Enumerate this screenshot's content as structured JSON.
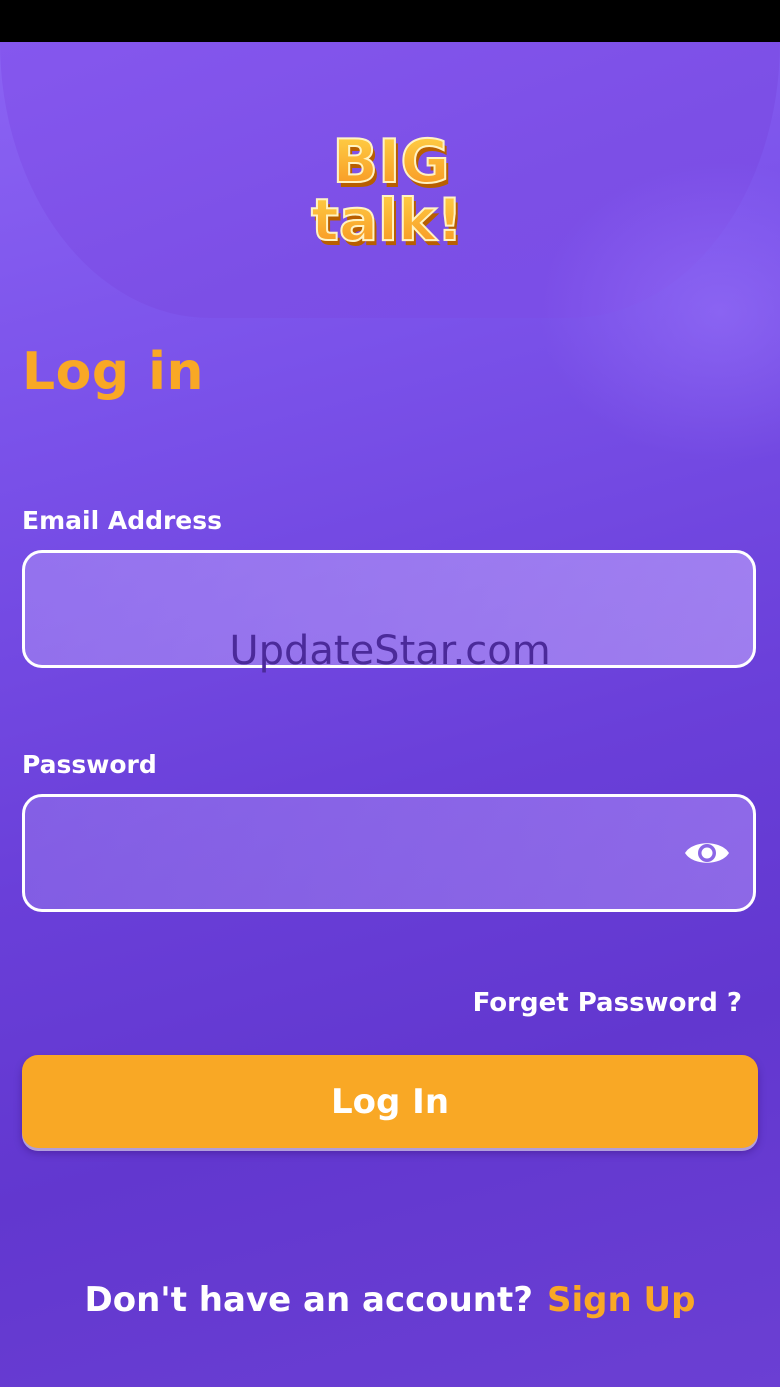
{
  "app": {
    "logo_line1": "BIG",
    "logo_line2": "talk!"
  },
  "login": {
    "title": "Log in",
    "email_label": "Email Address",
    "email_value": "",
    "password_label": "Password",
    "password_value": "",
    "forgot_label": "Forget Password ?",
    "submit_label": "Log In",
    "signup_prompt": "Don't have an account?",
    "signup_link": "Sign Up"
  },
  "watermark": "UpdateStar.com",
  "icons": {
    "password_toggle": "eye-icon"
  },
  "colors": {
    "accent": "#f9a825",
    "background": "#6a3fd9",
    "text": "#ffffff"
  }
}
